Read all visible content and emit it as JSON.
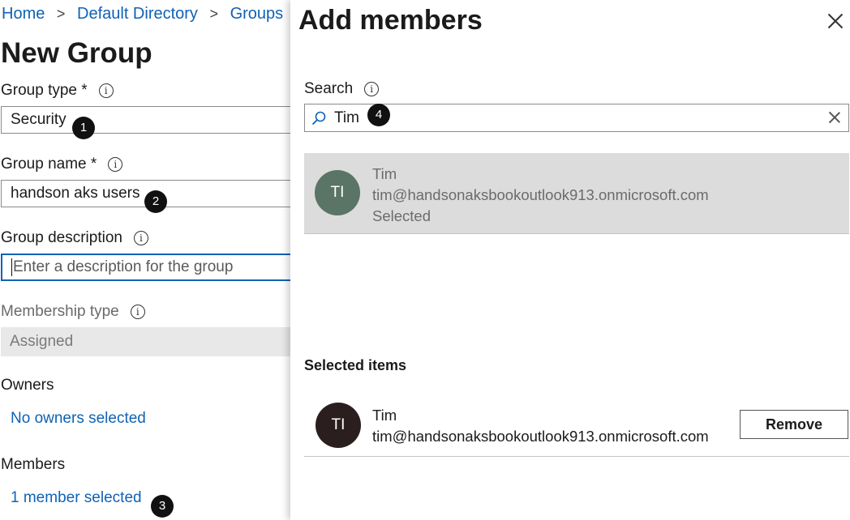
{
  "breadcrumb": {
    "items": [
      "Home",
      "Default Directory",
      "Groups"
    ],
    "separator": ">"
  },
  "form": {
    "title": "New Group",
    "group_type": {
      "label": "Group type *",
      "value": "Security"
    },
    "group_name": {
      "label": "Group name *",
      "value": "handson aks users"
    },
    "group_description": {
      "label": "Group description",
      "placeholder": "Enter a description for the group"
    },
    "membership_type": {
      "label": "Membership type",
      "value": "Assigned"
    },
    "owners": {
      "label": "Owners",
      "link": "No owners selected"
    },
    "members": {
      "label": "Members",
      "link": "1 member selected"
    }
  },
  "step_badges": [
    "1",
    "2",
    "3",
    "4"
  ],
  "blade": {
    "title": "Add members",
    "search": {
      "label": "Search",
      "value": "Tim"
    },
    "result": {
      "initials": "TI",
      "name": "Tim",
      "email": "tim@handsonaksbookoutlook913.onmicrosoft.com",
      "status": "Selected",
      "avatar_color": "#5a7466"
    },
    "selected_items": {
      "title": "Selected items",
      "items": [
        {
          "initials": "TI",
          "name": "Tim",
          "email": "tim@handsonaksbookoutlook913.onmicrosoft.com",
          "remove_label": "Remove",
          "avatar_color": "#2a1e1e"
        }
      ]
    }
  },
  "icons": {
    "info": "info-icon",
    "close": "close-icon",
    "search": "search-icon",
    "clear": "clear-icon"
  },
  "colors": {
    "link": "#0f62b5",
    "focus_border": "#0f62b5",
    "selected_row_bg": "#dcdcdc",
    "disabled_field_bg": "#e8e8e8"
  }
}
